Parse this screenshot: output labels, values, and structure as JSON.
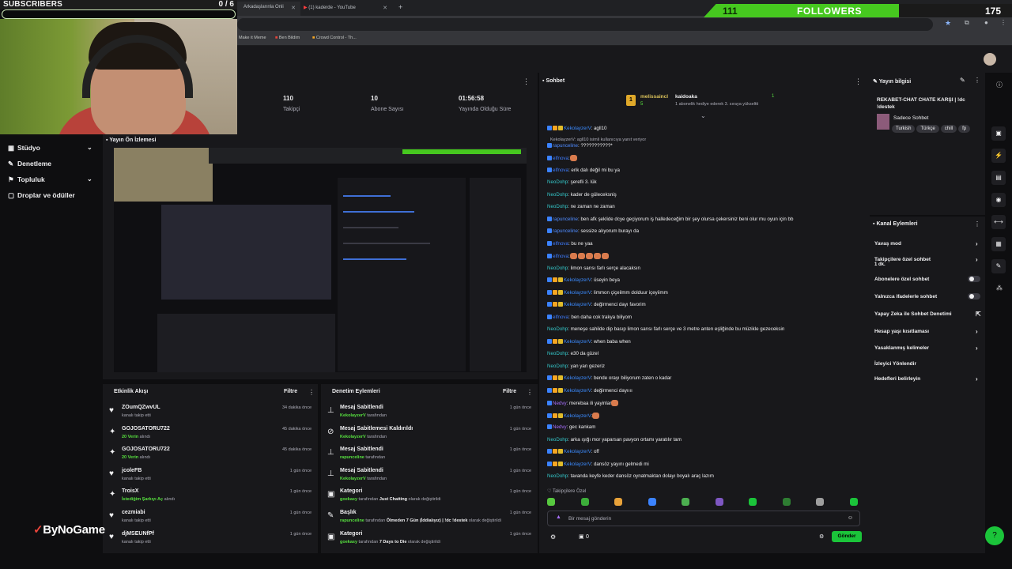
{
  "overlay": {
    "subscribers_label": "SUBSCRIBERS",
    "subscribers_count": "0 / 6",
    "followers_current": "111",
    "followers_label": "FOLLOWERS",
    "followers_goal": "175",
    "followers_progress": 0.634,
    "accent": "#46c81f"
  },
  "browser": {
    "tabs": [
      {
        "label": "Arkadaşlarınla Onli"
      },
      {
        "label": "(1) kaderde - YouTube"
      }
    ],
    "new_tab": "+",
    "bookmarks": [
      {
        "label": "Make it Meme"
      },
      {
        "label": "Ben Bildim"
      },
      {
        "label": "Crowd Control - Th..."
      }
    ]
  },
  "leftnav": {
    "items": [
      {
        "label": "Stüdyo",
        "icon": "studio-icon"
      },
      {
        "label": "Denetleme",
        "icon": "wrench-icon"
      },
      {
        "label": "Topluluk",
        "icon": "community-icon"
      },
      {
        "label": "Droplar ve ödüller",
        "icon": "gift-icon"
      }
    ]
  },
  "stats": [
    {
      "value": "110",
      "label": "Takipçi"
    },
    {
      "value": "10",
      "label": "Abone Sayısı"
    },
    {
      "value": "01:56:58",
      "label": "Yayında Olduğu Süre"
    }
  ],
  "preview": {
    "title": "Yayın Ön İzlemesi"
  },
  "activity": {
    "title": "Etkinlik Akışı",
    "filter": "Filtre",
    "rows": [
      {
        "name": "ZOumQZwvUL",
        "sub": "kanalı takip etti",
        "time": "34 dakika önce",
        "icon": "heart-icon"
      },
      {
        "name": "GOJOSATORU722",
        "sub": "20 Verin",
        "sub2": " alındı",
        "time": "45 dakika önce",
        "icon": "points-icon"
      },
      {
        "name": "GOJOSATORU722",
        "sub": "20 Verin",
        "sub2": " alındı",
        "time": "45 dakika önce",
        "icon": "points-icon"
      },
      {
        "name": "jcoleFB",
        "sub": "kanalı takip etti",
        "time": "1 gün önce",
        "icon": "heart-icon"
      },
      {
        "name": "TroisX",
        "sub": "İstediğim Şarkıyı Aç",
        "sub2": " alındı",
        "time": "1 gün önce",
        "icon": "points-icon"
      },
      {
        "name": "cezmiabi",
        "sub": "kanalı takip etti",
        "time": "1 gün önce",
        "icon": "heart-icon"
      },
      {
        "name": "djMSEUNfPf",
        "sub": "kanalı takip etti",
        "time": "1 gün önce",
        "icon": "heart-icon"
      }
    ]
  },
  "moderation": {
    "title": "Denetim Eylemleri",
    "filter": "Filtre",
    "rows": [
      {
        "name": "Mesaj Sabitlendi",
        "who": "KekolayzerV",
        "by": " tarafından",
        "time": "1 gün önce",
        "icon": "pin-icon"
      },
      {
        "name": "Mesaj Sabitlemesi Kaldırıldı",
        "who": "KekolayzerV",
        "by": " tarafından",
        "time": "1 gün önce",
        "icon": "unpin-icon"
      },
      {
        "name": "Mesaj Sabitlendi",
        "who": "rapunceline",
        "by": " tarafından",
        "time": "1 gün önce",
        "icon": "pin-icon"
      },
      {
        "name": "Mesaj Sabitlendi",
        "who": "KekolayzerV",
        "by": " tarafından",
        "time": "1 gün önce",
        "icon": "pin-icon"
      },
      {
        "name": "Kategori",
        "who": "goekasy",
        "by": " tarafından ",
        "what": "Just Chatting",
        "tail": " olarak değiştirildi",
        "time": "1 gün önce",
        "icon": "category-icon"
      },
      {
        "name": "Başlık",
        "who": "rapunceline",
        "by": " tarafından ",
        "what": "Ölmeden 7 Gün (İddialıyız) | !dc !destek",
        "tail": " olarak değiştirildi",
        "time": "1 gün önce",
        "icon": "title-icon"
      },
      {
        "name": "Kategori",
        "who": "goekasy",
        "by": " tarafından ",
        "what": "7 Days to Die",
        "tail": " olarak değiştirildi",
        "time": "1 gün önce",
        "icon": "category-icon"
      }
    ]
  },
  "chat": {
    "title": "Sohbet",
    "pinned": {
      "user1": "melissaincl",
      "user1_count": "5",
      "user2": "kaidoaka",
      "user2_text": "1 abonelik hediye ederek 3. sıraya yükseltti",
      "count": "1"
    },
    "reply_hint": "KekolayzerV: agll10 isimli kullanıcıya yanıt veriyor",
    "messages": [
      {
        "user": "KekolayzerV",
        "text": ": agll10",
        "cls": "u-kek",
        "badges": 3
      },
      {
        "user": "rapunceline",
        "text": ": ???????????*",
        "cls": "u-ra",
        "badges": 1
      },
      {
        "user": "elfnova",
        "text": ":",
        "cls": "u-el",
        "badges": 1,
        "emotes": 1
      },
      {
        "user": "elfnova",
        "text": ": erik dalı değil mi bu ya",
        "cls": "u-el",
        "badges": 1
      },
      {
        "user": "NeoDohp",
        "text": ": şerefli 3. lük",
        "cls": "u-neo",
        "badges": 0
      },
      {
        "user": "NeoDohp",
        "text": ": kader de güleceksniş",
        "cls": "u-neo",
        "badges": 0
      },
      {
        "user": "NeoDohp",
        "text": ": ne zaman ne zaman",
        "cls": "u-neo",
        "badges": 0
      },
      {
        "user": "rapunceline",
        "text": ": ben afk şeklide dcye geçiyorum iş halledeceğim bir şey olursa çekersiniz beni olur mu oyun için bb",
        "cls": "u-ra",
        "badges": 1
      },
      {
        "user": "rapunceline",
        "text": ": sessize alıyorum burayı da",
        "cls": "u-ra",
        "badges": 1
      },
      {
        "user": "elfnova",
        "text": ": bu ne yaa",
        "cls": "u-el",
        "badges": 1
      },
      {
        "user": "elfnova",
        "text": ":",
        "cls": "u-el",
        "badges": 1,
        "emotes": 5
      },
      {
        "user": "NeoDohp",
        "text": ": limon sarısı farlı serçe alacaksın",
        "cls": "u-neo",
        "badges": 0
      },
      {
        "user": "KekolayzerV",
        "text": ": üseyin beya",
        "cls": "u-kek",
        "badges": 3
      },
      {
        "user": "KekolayzerV",
        "text": ": limmon çiçeilmm dolduur içeyiimm",
        "cls": "u-kek",
        "badges": 3
      },
      {
        "user": "KekolayzerV",
        "text": ": değirmenci dayı favorim",
        "cls": "u-kek",
        "badges": 3
      },
      {
        "user": "elfnova",
        "text": ": ben daha cok trakya biliyom",
        "cls": "u-el",
        "badges": 1
      },
      {
        "user": "NeoDohp",
        "text": ": meneşe sahilde dip basıp limon sarısı farlı serçe ve 3 metre anten eşliğinde bu müzikle gezeceksin",
        "cls": "u-neo",
        "badges": 0
      },
      {
        "user": "KekolayzerV",
        "text": ": when baba when",
        "cls": "u-kek",
        "badges": 3
      },
      {
        "user": "NeoDohp",
        "text": ": e30 da güzel",
        "cls": "u-neo",
        "badges": 0
      },
      {
        "user": "NeoDohp",
        "text": ": yan yan gezeriz",
        "cls": "u-neo",
        "badges": 0
      },
      {
        "user": "KekolayzerV",
        "text": ": bende orayı biliyorum zaten o kadar",
        "cls": "u-kek",
        "badges": 3
      },
      {
        "user": "KekolayzerV",
        "text": ": değirmenci dayıııı",
        "cls": "u-kek",
        "badges": 3
      },
      {
        "user": "Nedvy",
        "text": ": merebaa ili yayinlar",
        "cls": "u-ned",
        "badges": 1,
        "emotes": 1
      },
      {
        "user": "KekolayzerV",
        "text": ":",
        "cls": "u-kek",
        "badges": 3,
        "emotes": 1
      },
      {
        "user": "Nedvy",
        "text": ": gec kankam",
        "cls": "u-ned",
        "badges": 1
      },
      {
        "user": "NeoDohp",
        "text": ": arka ışığı mor yaparsan pavyon ortamı yaratılır tam",
        "cls": "u-neo",
        "badges": 0
      },
      {
        "user": "KekolayzerV",
        "text": ": off",
        "cls": "u-kek",
        "badges": 3
      },
      {
        "user": "KekolayzerV",
        "text": ": dansöz yayını gelmedi mi",
        "cls": "u-kek",
        "badges": 3
      },
      {
        "user": "NeoDohp",
        "text": ": tavanda keyfe keder dansöz oynatmaktan dolayı boyalı araç lazım",
        "cls": "u-neo",
        "badges": 0
      }
    ],
    "followers_only": "Takipçilere Özel",
    "input_placeholder": "Bir mesaj gönderin",
    "points": "0",
    "send": "Gönder"
  },
  "stream_info": {
    "title": "Yayın bilgisi",
    "stream_title": "REKABET-CHAT CHATE KARŞI | !dc !destek",
    "category": "Sadece Sohbet",
    "tags": [
      "Turkish",
      "Türkçe",
      "chill",
      "fp"
    ]
  },
  "channel_actions": {
    "title": "Kanal Eylemleri",
    "items": [
      {
        "label": "Yavaş mod",
        "kind": "arrow"
      },
      {
        "label": "Takipçilere özel sohbet",
        "sub": "1 dk.",
        "kind": "arrow"
      },
      {
        "label": "Abonelere özel sohbet",
        "kind": "toggle"
      },
      {
        "label": "Yalnızca ifadelerle sohbet",
        "kind": "toggle"
      },
      {
        "label": "Yapay Zeka ile Sohbet Denetimi",
        "kind": "external"
      },
      {
        "label": "Hesap yaşı kısıtlaması",
        "kind": "arrow"
      },
      {
        "label": "Yasaklanmış kelimeler",
        "kind": "arrow"
      },
      {
        "label": "İzleyici Yönlendir",
        "kind": "none"
      },
      {
        "label": "Hedefleri belirleyin",
        "kind": "arrow"
      }
    ]
  },
  "brand": {
    "name": "ByNoGame"
  }
}
